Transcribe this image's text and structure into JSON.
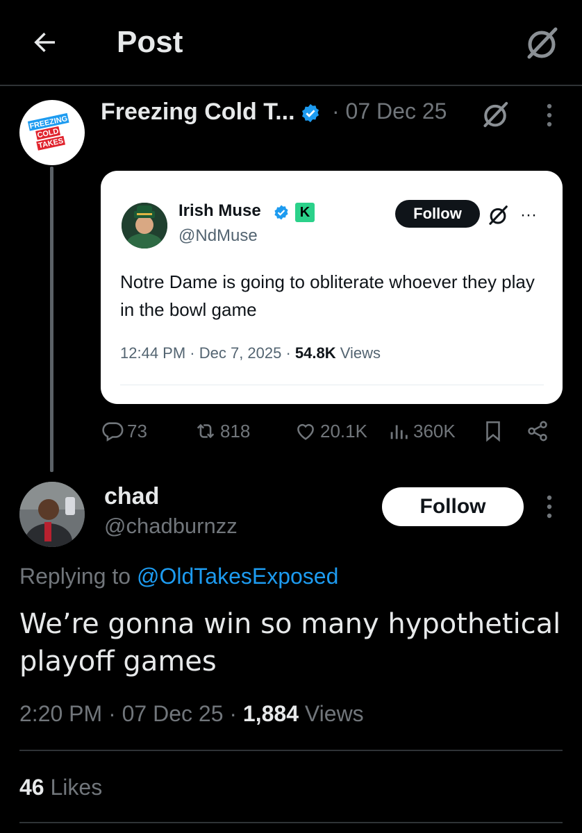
{
  "header": {
    "title": "Post",
    "back_icon": "arrow-left-icon",
    "grok_icon": "grok-icon"
  },
  "quoted_post": {
    "avatar_text": [
      "FREEZING",
      "COLD",
      "TAKES"
    ],
    "author_name": "Freezing Cold T...",
    "date": "· 07 Dec 25",
    "verified_color": "#1d9bf0",
    "embedded": {
      "name": "Irish Muse",
      "handle": "@NdMuse",
      "badge": "K",
      "follow_label": "Follow",
      "more_label": "···",
      "text": "Notre Dame is going to obliterate whoever they play in the bowl game",
      "time": "12:44 PM · Dec 7, 2025 · ",
      "views_count": "54.8K",
      "views_label": " Views"
    },
    "stats": {
      "replies": "73",
      "reposts": "818",
      "likes": "20.1K",
      "views": "360K"
    }
  },
  "reply": {
    "name": "chad",
    "handle": "@chadburnzz",
    "follow_label": "Follow",
    "replying_prefix": "Replying to ",
    "replying_to": "@OldTakesExposed",
    "text": "We’re gonna win so many hypothetical playoff games",
    "time": "2:20 PM · 07 Dec 25 · ",
    "views_count": "1,884",
    "views_label": " Views",
    "likes_count": "46",
    "likes_label": " Likes"
  },
  "colors": {
    "background": "#000000",
    "text": "#e7e9ea",
    "muted": "#71767b",
    "accent": "#1d9bf0",
    "divider": "#2f3336"
  }
}
